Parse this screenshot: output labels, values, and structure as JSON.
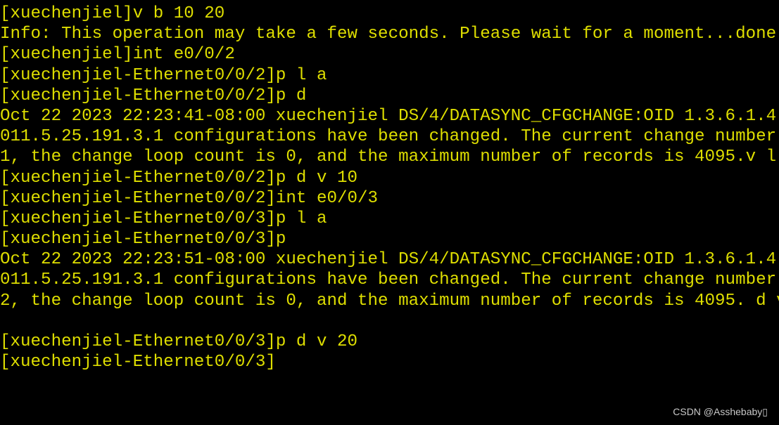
{
  "terminal": {
    "text_color": "#dede00",
    "background": "#000000",
    "lines": [
      "[xuechenjiel]v b 10 20",
      "Info: This operation may take a few seconds. Please wait for a moment...done",
      "[xuechenjiel]int e0/0/2",
      "[xuechenjiel-Ethernet0/0/2]p l a",
      "[xuechenjiel-Ethernet0/0/2]p d",
      "Oct 22 2023 22:23:41-08:00 xuechenjiel DS/4/DATASYNC_CFGCHANGE:OID 1.3.6.1.4",
      "011.5.25.191.3.1 configurations have been changed. The current change number",
      "1, the change loop count is 0, and the maximum number of records is 4095.v l",
      "[xuechenjiel-Ethernet0/0/2]p d v 10",
      "[xuechenjiel-Ethernet0/0/2]int e0/0/3",
      "[xuechenjiel-Ethernet0/0/3]p l a",
      "[xuechenjiel-Ethernet0/0/3]p",
      "Oct 22 2023 22:23:51-08:00 xuechenjiel DS/4/DATASYNC_CFGCHANGE:OID 1.3.6.1.4",
      "011.5.25.191.3.1 configurations have been changed. The current change number",
      "2, the change loop count is 0, and the maximum number of records is 4095. d v",
      "",
      "[xuechenjiel-Ethernet0/0/3]p d v 20",
      "[xuechenjiel-Ethernet0/0/3]"
    ]
  },
  "watermark": "CSDN @Asshebaby▯"
}
